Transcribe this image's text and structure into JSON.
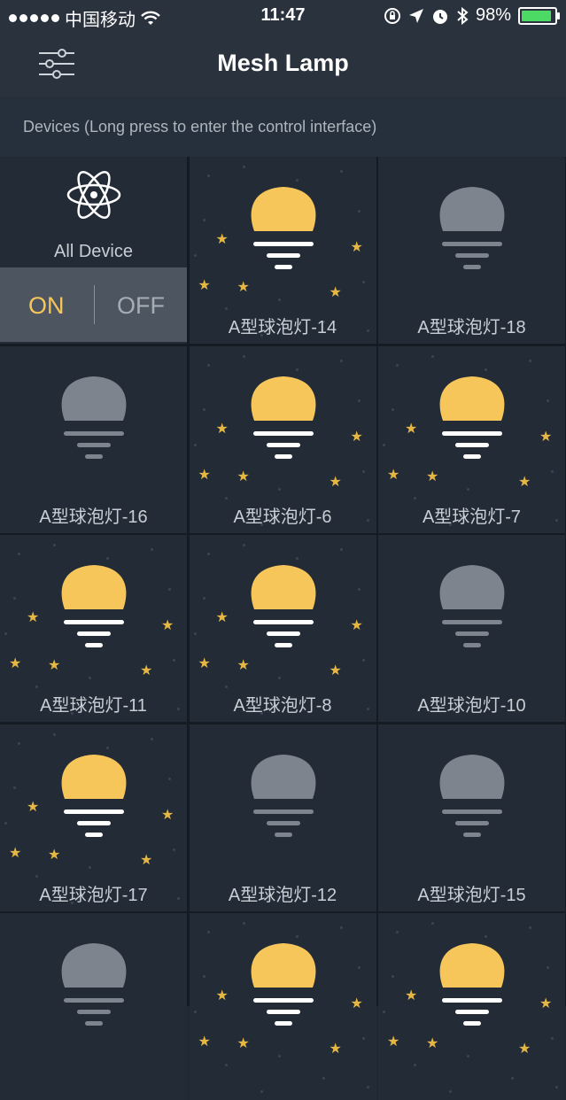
{
  "status": {
    "carrier": "中国移动",
    "time": "11:47",
    "battery": "98%"
  },
  "nav": {
    "title": "Mesh Lamp"
  },
  "section": {
    "header": "Devices (Long press to enter the control interface)"
  },
  "all_device": {
    "label": "All Device",
    "on": "ON",
    "off": "OFF"
  },
  "colors": {
    "bulb_on": "#f7c65b",
    "bulb_off": "#7d848d",
    "background": "#222b36"
  },
  "devices": [
    {
      "name": "A型球泡灯-14",
      "on": true
    },
    {
      "name": "A型球泡灯-18",
      "on": false
    },
    {
      "name": "A型球泡灯-16",
      "on": false
    },
    {
      "name": "A型球泡灯-6",
      "on": true
    },
    {
      "name": "A型球泡灯-7",
      "on": true
    },
    {
      "name": "A型球泡灯-11",
      "on": true
    },
    {
      "name": "A型球泡灯-8",
      "on": true
    },
    {
      "name": "A型球泡灯-10",
      "on": false
    },
    {
      "name": "A型球泡灯-17",
      "on": true
    },
    {
      "name": "A型球泡灯-12",
      "on": false
    },
    {
      "name": "A型球泡灯-15",
      "on": false
    },
    {
      "name": "",
      "on": false
    },
    {
      "name": "",
      "on": true
    },
    {
      "name": "",
      "on": true
    }
  ]
}
